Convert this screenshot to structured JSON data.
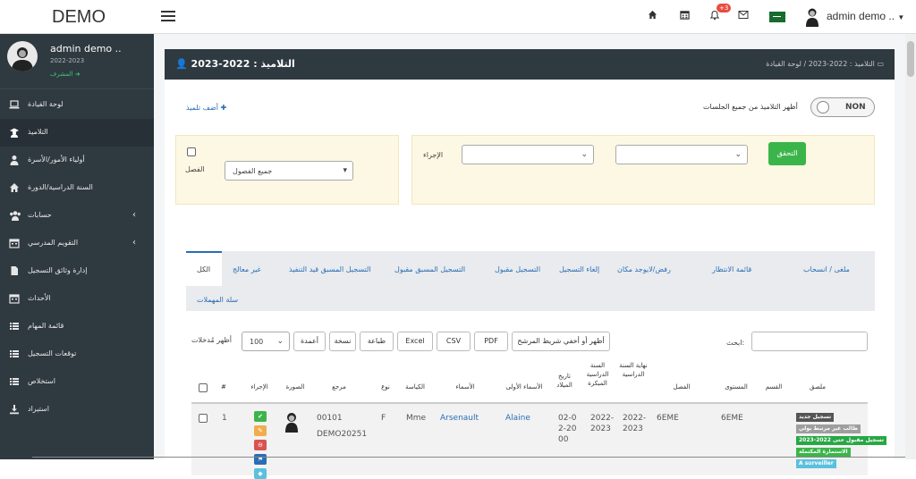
{
  "app": {
    "brand": "DEMO",
    "user_name": "admin demo ..",
    "notif_count": "+3"
  },
  "sidebar": {
    "profile": {
      "name": "admin demo ..",
      "year": "2022-2023",
      "role": "المشرف"
    },
    "items": [
      {
        "label": "لوحة القيادة",
        "icon": "laptop-icon"
      },
      {
        "label": "التلاميذ",
        "icon": "student-icon"
      },
      {
        "label": "أولياء الأمور/الأسرة",
        "icon": "user-icon"
      },
      {
        "label": "السنة الدراسية/الدورة",
        "icon": "home-icon"
      },
      {
        "label": "حسابات",
        "icon": "users-icon"
      },
      {
        "label": "التقويم المدرسي",
        "icon": "calendar-icon"
      },
      {
        "label": "إدارة وثائق التسجيل",
        "icon": "file-icon"
      },
      {
        "label": "الأحداث",
        "icon": "calendar-icon"
      },
      {
        "label": "قائمة المهام",
        "icon": "list-icon"
      },
      {
        "label": "توقعات التسجيل",
        "icon": "list-icon"
      },
      {
        "label": "استخلاص",
        "icon": "list-icon"
      },
      {
        "label": "استيراد",
        "icon": "download-icon"
      }
    ]
  },
  "header": {
    "title": "التلاميذ : 2022-2023",
    "crumb_dashboard": "لوحة القيادة",
    "crumb_current": "التلاميذ : 2022-2023"
  },
  "toolbar": {
    "add_student": "أضف تلميذ",
    "toggle_text": "NON",
    "toggle_label": "أظهر التلاميذ من جميع الجلسات"
  },
  "filters": {
    "class_label": "الفصل",
    "class_value": "جميع الفصول",
    "action_label": "الإجراء",
    "verify_button": "التحقق"
  },
  "tabs": {
    "active": "الكل",
    "items": [
      "غير معالج",
      "التسجيل المسبق قيد التنفيذ",
      "التسجيل المسبق مقبول",
      "التسجيل مقبول",
      "إلغاء التسجيل",
      "رفض/لايوجد مكان",
      "قائمة الانتظار",
      "ملغى / انسحاب"
    ],
    "trash": "سلة المهملات"
  },
  "table_tools": {
    "show_label": "أظهر مُدخلات",
    "show_value": "100",
    "columns": "أعمدة",
    "copy": "نسخة",
    "print": "طباعة",
    "excel": "Excel",
    "csv": "CSV",
    "pdf": "PDF",
    "toggle_filter": "أظهر أو أخفي شريط المرشح",
    "search_label": "ابحث:"
  },
  "table": {
    "headers": {
      "num": "#",
      "action": "الإجراء",
      "photo": "الصورة",
      "ref": "مرجع",
      "gender": "نوع",
      "title": "الكياسة",
      "name": "الأسماء",
      "firstname": "الأسماء الأولى",
      "dob": "تاريخ الميلاد",
      "early_year": "السنة الدراسية المبكرة",
      "end_year": "نهاية السنة الدراسية",
      "class": "الفصل",
      "level": "المستوى",
      "section": "القسم",
      "attached": "ملصق"
    },
    "rows": [
      {
        "num": "1",
        "ref1": "00101",
        "ref2": "DEMO20251",
        "gender": "F",
        "title": "Mme",
        "name": "Arsenault",
        "firstname": "Alaine",
        "dob": "02-02-2000",
        "early_year": "2022-2023",
        "end_year": "2022-2023",
        "class": "6EME",
        "level": "6EME",
        "tags": [
          {
            "text": "تسجيل جديد",
            "color": "#555555"
          },
          {
            "text": "طالب غير مرتبط بولي",
            "color": "#9e9e9e"
          },
          {
            "text": "تسجيل مقبول حتى 2022-2023",
            "color": "#28a745"
          },
          {
            "text": "الاستمارة المكتملة",
            "color": "#3bb54a"
          },
          {
            "text": "A surveiller",
            "color": "#5bc0de"
          }
        ]
      }
    ]
  },
  "colors": {
    "sidebar": "#2f3940",
    "accent": "#2a6db5",
    "green": "#3bb54a"
  }
}
